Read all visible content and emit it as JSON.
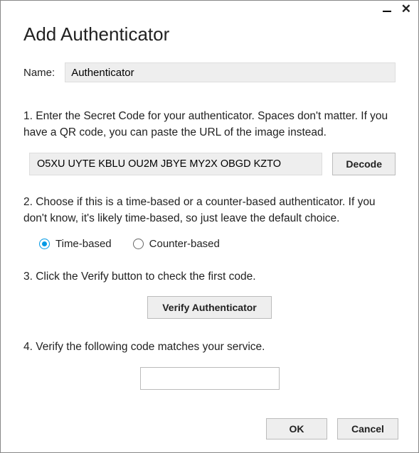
{
  "window": {
    "title": "Add Authenticator"
  },
  "name_field": {
    "label": "Name:",
    "value": "Authenticator"
  },
  "steps": {
    "s1": "1. Enter the Secret Code for your authenticator. Spaces don't matter. If you have a QR code, you can paste the URL of the image instead.",
    "s2": "2. Choose if this is a time-based or a counter-based authenticator. If you don't know, it's likely time-based, so just leave the default choice.",
    "s3": "3. Click the Verify button to check the first code.",
    "s4": "4. Verify the following code matches your service."
  },
  "secret": {
    "value": "O5XU UYTE KBLU OU2M JBYE MY2X OBGD KZTO",
    "decode_label": "Decode"
  },
  "radios": {
    "time_label": "Time-based",
    "counter_label": "Counter-based",
    "selected": "time"
  },
  "verify": {
    "button_label": "Verify Authenticator"
  },
  "code": {
    "value": ""
  },
  "footer": {
    "ok_label": "OK",
    "cancel_label": "Cancel"
  }
}
